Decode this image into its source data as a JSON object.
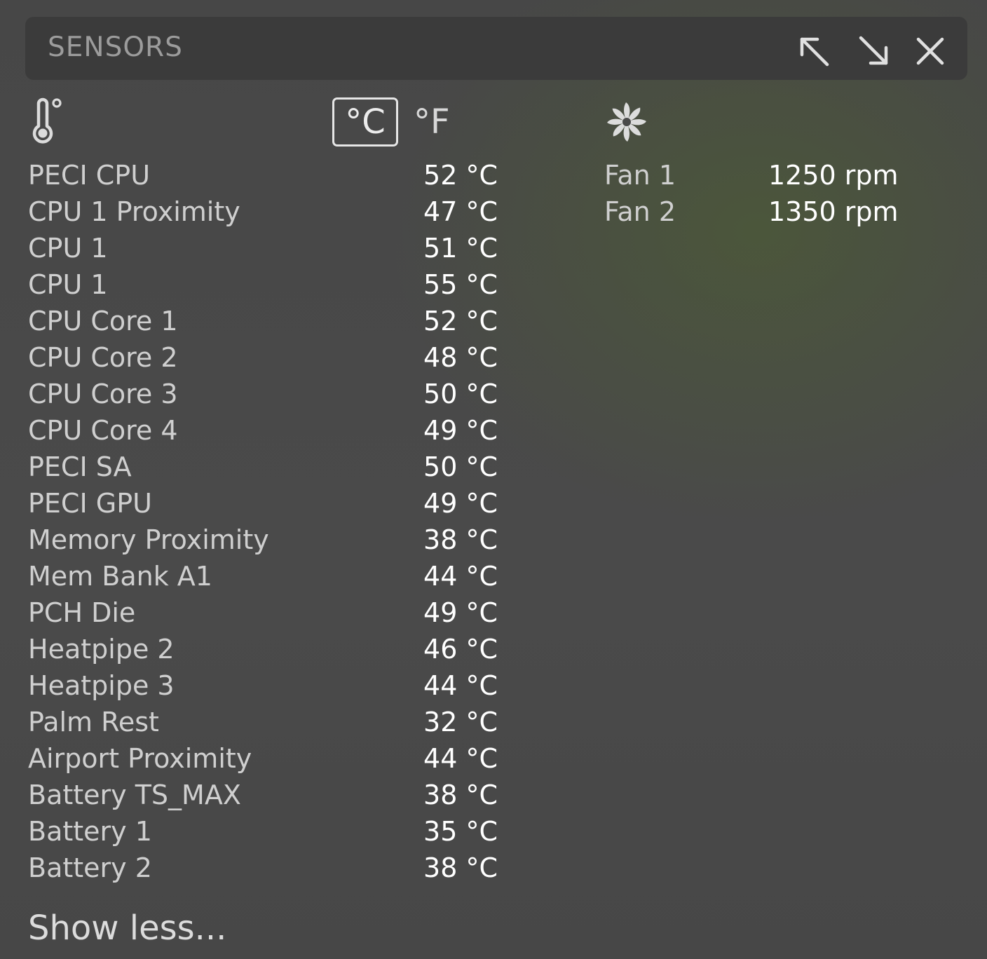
{
  "header": {
    "title": "SENSORS",
    "buttons": [
      "expand-up-left-icon",
      "expand-down-right-icon",
      "close-icon"
    ]
  },
  "units": {
    "celsius": "°C",
    "fahrenheit": "°F",
    "selected": "celsius"
  },
  "icons": {
    "temperature": "thermometer-icon",
    "fans": "fan-icon"
  },
  "temperatures": [
    {
      "name": "PECI CPU",
      "value": "52 °C"
    },
    {
      "name": "CPU 1 Proximity",
      "value": "47 °C"
    },
    {
      "name": "CPU 1",
      "value": "51 °C"
    },
    {
      "name": "CPU 1",
      "value": "55 °C"
    },
    {
      "name": "CPU Core 1",
      "value": "52 °C"
    },
    {
      "name": "CPU Core 2",
      "value": "48 °C"
    },
    {
      "name": "CPU Core 3",
      "value": "50 °C"
    },
    {
      "name": "CPU Core 4",
      "value": "49 °C"
    },
    {
      "name": "PECI SA",
      "value": "50 °C"
    },
    {
      "name": "PECI GPU",
      "value": "49 °C"
    },
    {
      "name": "Memory Proximity",
      "value": "38 °C"
    },
    {
      "name": "Mem Bank A1",
      "value": "44 °C"
    },
    {
      "name": "PCH Die",
      "value": "49 °C"
    },
    {
      "name": "Heatpipe 2",
      "value": "46 °C"
    },
    {
      "name": "Heatpipe 3",
      "value": "44 °C"
    },
    {
      "name": "Palm Rest",
      "value": "32 °C"
    },
    {
      "name": "Airport Proximity",
      "value": "44 °C"
    },
    {
      "name": "Battery TS_MAX",
      "value": "38 °C"
    },
    {
      "name": "Battery 1",
      "value": "35 °C"
    },
    {
      "name": "Battery 2",
      "value": "38 °C"
    }
  ],
  "fans": [
    {
      "name": "Fan 1",
      "value": "1250 rpm"
    },
    {
      "name": "Fan 2",
      "value": "1350 rpm"
    }
  ],
  "footer": {
    "toggle_label": "Show less..."
  }
}
